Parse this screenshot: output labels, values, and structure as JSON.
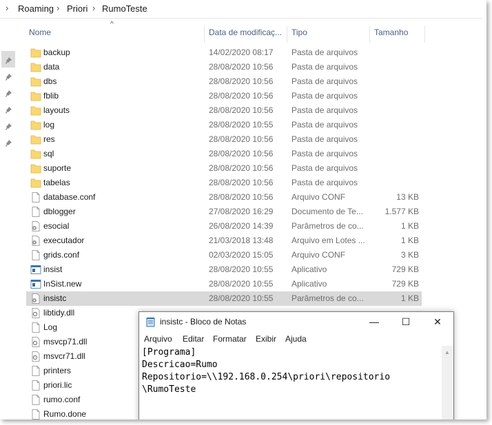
{
  "breadcrumb": [
    "Roaming",
    "Priori",
    "RumoTeste"
  ],
  "columns": {
    "name": "Nome",
    "date": "Data de modificaç...",
    "type": "Tipo",
    "size": "Tamanho"
  },
  "files": [
    {
      "name": "backup",
      "date": "14/02/2020 08:17",
      "type": "Pasta de arquivos",
      "size": "",
      "icon": "folder-icon"
    },
    {
      "name": "data",
      "date": "28/08/2020 10:56",
      "type": "Pasta de arquivos",
      "size": "",
      "icon": "folder-icon"
    },
    {
      "name": "dbs",
      "date": "28/08/2020 10:56",
      "type": "Pasta de arquivos",
      "size": "",
      "icon": "folder-icon"
    },
    {
      "name": "fblib",
      "date": "28/08/2020 10:56",
      "type": "Pasta de arquivos",
      "size": "",
      "icon": "folder-icon"
    },
    {
      "name": "layouts",
      "date": "28/08/2020 10:56",
      "type": "Pasta de arquivos",
      "size": "",
      "icon": "folder-icon"
    },
    {
      "name": "log",
      "date": "28/08/2020 10:55",
      "type": "Pasta de arquivos",
      "size": "",
      "icon": "folder-icon"
    },
    {
      "name": "res",
      "date": "28/08/2020 10:56",
      "type": "Pasta de arquivos",
      "size": "",
      "icon": "folder-icon"
    },
    {
      "name": "sql",
      "date": "28/08/2020 10:56",
      "type": "Pasta de arquivos",
      "size": "",
      "icon": "folder-icon"
    },
    {
      "name": "suporte",
      "date": "28/08/2020 10:56",
      "type": "Pasta de arquivos",
      "size": "",
      "icon": "folder-icon"
    },
    {
      "name": "tabelas",
      "date": "28/08/2020 10:56",
      "type": "Pasta de arquivos",
      "size": "",
      "icon": "folder-icon"
    },
    {
      "name": "database.conf",
      "date": "28/08/2020 10:56",
      "type": "Arquivo CONF",
      "size": "13 KB",
      "icon": "file-icon"
    },
    {
      "name": "dblogger",
      "date": "27/08/2020 16:29",
      "type": "Documento de Te...",
      "size": "1.577 KB",
      "icon": "file-icon"
    },
    {
      "name": "esocial",
      "date": "26/08/2020 14:39",
      "type": "Parâmetros de co...",
      "size": "1 KB",
      "icon": "settings-file-icon"
    },
    {
      "name": "executador",
      "date": "21/03/2018 13:48",
      "type": "Arquivo em Lotes ...",
      "size": "1 KB",
      "icon": "settings-file-icon"
    },
    {
      "name": "grids.conf",
      "date": "02/03/2020 15:05",
      "type": "Arquivo CONF",
      "size": "3 KB",
      "icon": "file-icon"
    },
    {
      "name": "insist",
      "date": "28/08/2020 10:55",
      "type": "Aplicativo",
      "size": "729 KB",
      "icon": "app-icon"
    },
    {
      "name": "InSist.new",
      "date": "28/08/2020 10:55",
      "type": "Aplicativo",
      "size": "729 KB",
      "icon": "app-icon"
    },
    {
      "name": "insistc",
      "date": "28/08/2020 10:55",
      "type": "Parâmetros de co...",
      "size": "1 KB",
      "icon": "settings-file-icon",
      "selected": true
    },
    {
      "name": "libtidy.dll",
      "date": "",
      "type": "",
      "size": "",
      "icon": "dll-icon"
    },
    {
      "name": "Log",
      "date": "",
      "type": "",
      "size": "",
      "icon": "file-icon"
    },
    {
      "name": "msvcp71.dll",
      "date": "",
      "type": "",
      "size": "",
      "icon": "dll-icon"
    },
    {
      "name": "msvcr71.dll",
      "date": "",
      "type": "",
      "size": "",
      "icon": "dll-icon"
    },
    {
      "name": "printers",
      "date": "",
      "type": "",
      "size": "",
      "icon": "file-icon"
    },
    {
      "name": "priori.lic",
      "date": "",
      "type": "",
      "size": "",
      "icon": "file-icon"
    },
    {
      "name": "rumo.conf",
      "date": "",
      "type": "",
      "size": "",
      "icon": "file-icon"
    },
    {
      "name": "Rumo.done",
      "date": "",
      "type": "",
      "size": "",
      "icon": "file-icon"
    }
  ],
  "notepad": {
    "title": "insistc - Bloco de Notas",
    "menu": [
      "Arquivo",
      "Editar",
      "Formatar",
      "Exibir",
      "Ajuda"
    ],
    "lines": [
      "[Programa]",
      "Descricao=Rumo",
      "Repositorio=\\\\192.168.0.254\\priori\\repositorio",
      "\\RumoTeste"
    ],
    "controls": {
      "minimize": "—",
      "maximize": "☐",
      "close": "✕"
    }
  }
}
